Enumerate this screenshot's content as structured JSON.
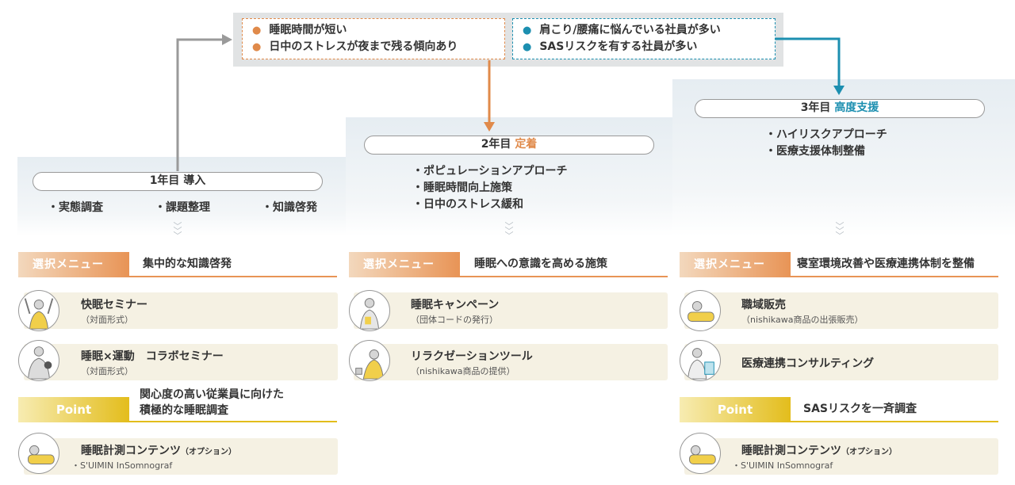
{
  "issues": {
    "left": [
      "睡眠時間が短い",
      "日中のストレスが夜まで残る傾向あり"
    ],
    "right": [
      "肩こり/腰痛に悩んでいる社員が多い",
      "SASリスクを有する社員が多い"
    ]
  },
  "years": [
    {
      "label": "1年目",
      "accent": "導入",
      "bullets": [
        "・実態調査",
        "・課題整理",
        "・知識啓発"
      ]
    },
    {
      "label": "2年目",
      "accent": "定着",
      "bullets": [
        "・ポピュレーションアプローチ",
        "・睡眠時間向上施策",
        "・日中のストレス緩和"
      ]
    },
    {
      "label": "3年目",
      "accent": "高度支援",
      "bullets": [
        "・ハイリスクアプローチ",
        "・医療支援体制整備"
      ]
    }
  ],
  "menu_label": "選択メニュー",
  "point_label": "Point",
  "columns": [
    {
      "menu_desc": "集中的な知識啓発",
      "items": [
        {
          "title": "快眠セミナー",
          "sub": "（対面形式）"
        },
        {
          "title": "睡眠×運動　コラボセミナー",
          "sub": "（対面形式）"
        }
      ],
      "point_desc": [
        "関心度の高い従業員に向けた",
        "積極的な睡眠調査"
      ],
      "point_item": {
        "title": "睡眠計測コンテンツ",
        "note": "（オプション）",
        "sub": "・S'UIMIN InSomnograf"
      }
    },
    {
      "menu_desc": "睡眠への意識を高める施策",
      "items": [
        {
          "title": "睡眠キャンペーン",
          "sub": "（団体コードの発行）"
        },
        {
          "title": "リラクゼーションツール",
          "sub": "（nishikawa商品の提供）"
        }
      ]
    },
    {
      "menu_desc": "寝室環境改善や医療連携体制を整備",
      "items": [
        {
          "title": "職域販売",
          "sub": "（nishikawa商品の出張販売）"
        },
        {
          "title": "医療連携コンサルティング",
          "sub": ""
        }
      ],
      "point_desc": [
        "SASリスクを一斉調査"
      ],
      "point_item": {
        "title": "睡眠計測コンテンツ",
        "note": "（オプション）",
        "sub": "・S'UIMIN InSomnograf"
      }
    }
  ],
  "colors": {
    "orange": "#e08a4a",
    "blue": "#1c8fb0",
    "gold": "#e3bd1c",
    "gray_arrow": "#9a9a9a"
  }
}
